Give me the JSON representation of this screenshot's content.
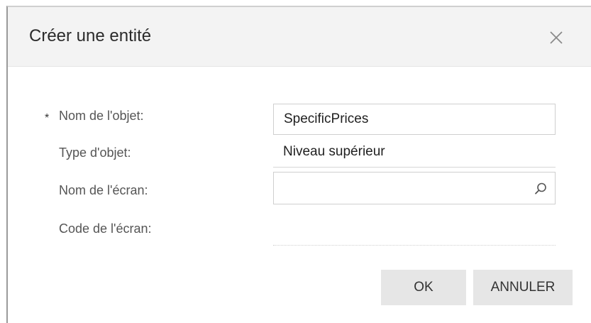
{
  "dialog": {
    "title": "Créer une entité",
    "close_icon": "close-icon"
  },
  "form": {
    "object_name": {
      "label": "Nom de l'objet:",
      "required_marker": "*",
      "value": "SpecificPrices"
    },
    "object_type": {
      "label": "Type d'objet:",
      "value": "Niveau supérieur"
    },
    "screen_name": {
      "label": "Nom de l'écran:",
      "value": "",
      "icon": "search-icon"
    },
    "screen_code": {
      "label": "Code de l'écran:",
      "value": ""
    }
  },
  "buttons": {
    "ok": "OK",
    "cancel": "ANNULER"
  },
  "colors": {
    "header_bg": "#f3f3f3",
    "button_bg": "#e6e6e6",
    "label_text": "#555555",
    "border": "#cfcfcf"
  }
}
